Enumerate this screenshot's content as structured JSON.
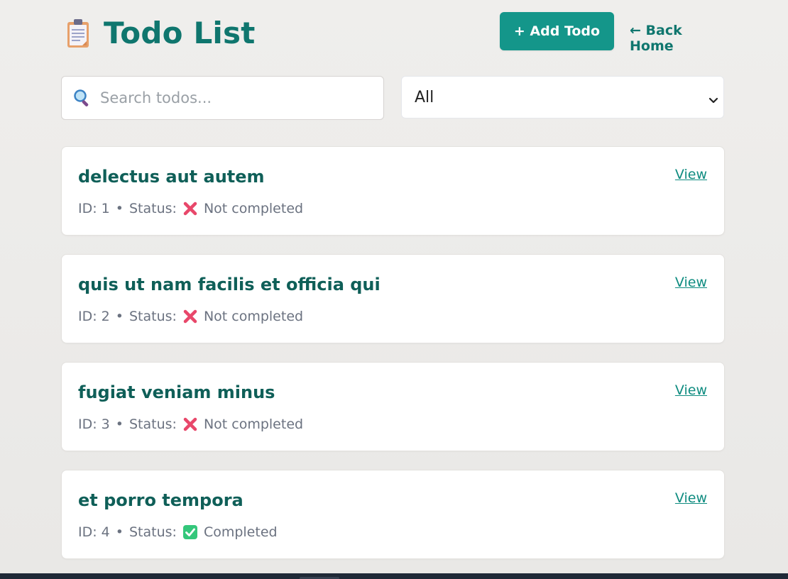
{
  "header": {
    "title": "Todo List",
    "title_icon": "clipboard-icon",
    "add_button_label": "+ Add Todo",
    "back_link_label": "← Back Home"
  },
  "search": {
    "placeholder": "Search todos...",
    "value": "",
    "icon": "search-icon"
  },
  "filter": {
    "selected": "All"
  },
  "todos": [
    {
      "title": "delectus aut autem",
      "id_text": "ID: 1",
      "status_label": "Status:",
      "status_text": "Not completed",
      "status_icon": "cross-mark-icon",
      "view_label": "View"
    },
    {
      "title": "quis ut nam facilis et officia qui",
      "id_text": "ID: 2",
      "status_label": "Status:",
      "status_text": "Not completed",
      "status_icon": "cross-mark-icon",
      "view_label": "View"
    },
    {
      "title": "fugiat veniam minus",
      "id_text": "ID: 3",
      "status_label": "Status:",
      "status_text": "Not completed",
      "status_icon": "cross-mark-icon",
      "view_label": "View"
    },
    {
      "title": "et porro tempora",
      "id_text": "ID: 4",
      "status_label": "Status:",
      "status_text": "Completed",
      "status_icon": "check-mark-icon",
      "view_label": "View"
    }
  ],
  "separator": "•",
  "colors": {
    "accent": "#0f766e",
    "button": "#14968a",
    "not_completed": "#e11d48",
    "completed": "#22c55e"
  }
}
